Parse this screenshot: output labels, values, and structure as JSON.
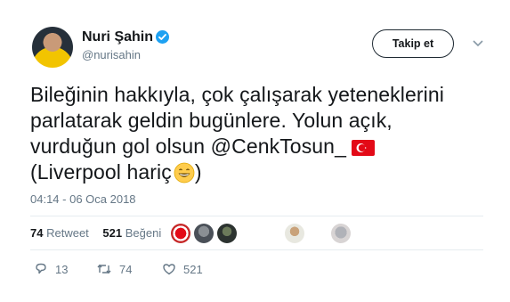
{
  "user": {
    "display_name": "Nuri Şahin",
    "handle": "@nurisahin"
  },
  "follow_button_label": "Takip et",
  "tweet": {
    "lines": [
      "Bileğinin hakkıyla, çok çalışarak yeteneklerini",
      "parlatarak geldin bugünlere. Yolun açık,",
      "vurduğun gol olsun ",
      "(Liverpool hariç",
      ")"
    ],
    "mention": "@CenkTosun_",
    "timestamp": "04:14 - 06 Oca 2018"
  },
  "stats": {
    "retweets_count": "74",
    "retweets_label": "Retweet",
    "likes_count": "521",
    "likes_label": "Beğeni"
  },
  "actions": {
    "reply_count": "13",
    "retweet_count": "74",
    "like_count": "521"
  },
  "icons": {
    "verified": "verified-badge-icon",
    "caret": "chevron-down-icon",
    "flag": "turkey-flag-icon",
    "emoji": "grinning-face-icon",
    "reply": "reply-icon",
    "retweet": "retweet-icon",
    "like": "heart-icon"
  },
  "colors": {
    "verified_blue": "#1da1f2",
    "secondary_text": "#657786",
    "turkey_red": "#e30a17"
  }
}
